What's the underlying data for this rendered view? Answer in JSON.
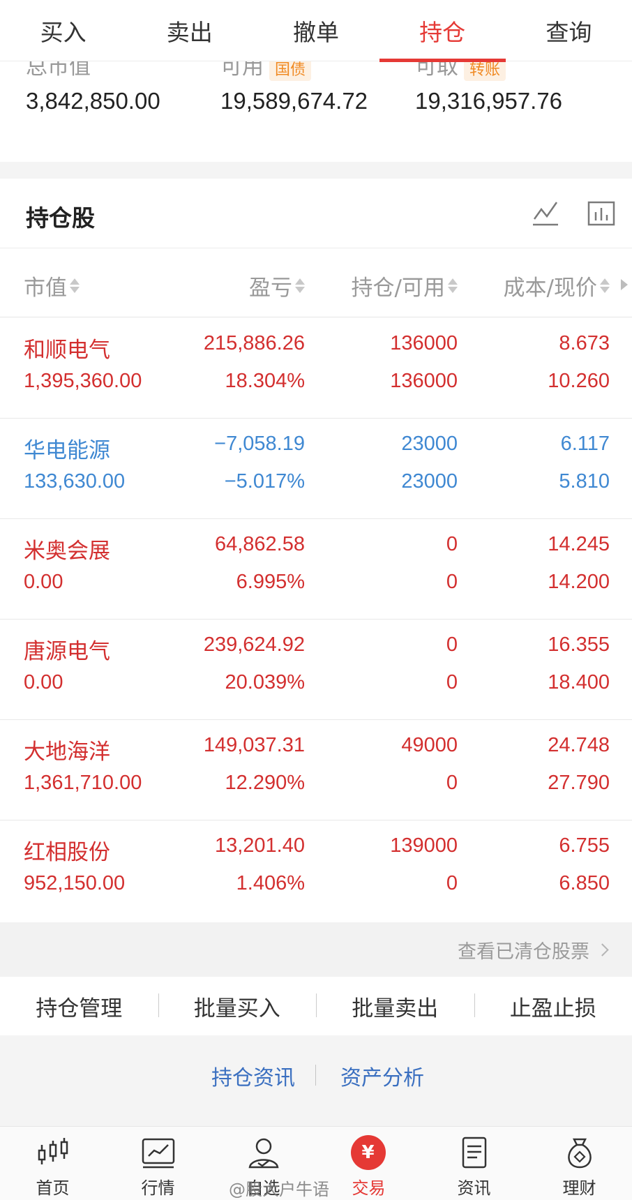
{
  "top_tabs": [
    {
      "label": "买入"
    },
    {
      "label": "卖出"
    },
    {
      "label": "撤单"
    },
    {
      "label": "持仓"
    },
    {
      "label": "查询"
    }
  ],
  "summary": {
    "market_value": {
      "label": "总市值",
      "value": "3,842,850.00"
    },
    "available": {
      "label": "可用",
      "tag": "国债",
      "value": "19,589,674.72"
    },
    "withdrawable": {
      "label": "可取",
      "tag": "转账",
      "value": "19,316,957.76"
    }
  },
  "holdings": {
    "title": "持仓股",
    "icons": [
      "trend-line-icon",
      "bar-chart-icon"
    ],
    "columns": [
      "市值",
      "盈亏",
      "持仓/可用",
      "成本/现价"
    ],
    "rows": [
      {
        "name": "和顺电气",
        "market_value": "1,395,360.00",
        "pnl": "215,886.26",
        "pnl_pct": "18.304%",
        "position": "136000",
        "available": "136000",
        "cost": "8.673",
        "price": "10.260",
        "trend": "up"
      },
      {
        "name": "华电能源",
        "market_value": "133,630.00",
        "pnl": "−7,058.19",
        "pnl_pct": "−5.017%",
        "position": "23000",
        "available": "23000",
        "cost": "6.117",
        "price": "5.810",
        "trend": "down"
      },
      {
        "name": "米奥会展",
        "market_value": "0.00",
        "pnl": "64,862.58",
        "pnl_pct": "6.995%",
        "position": "0",
        "available": "0",
        "cost": "14.245",
        "price": "14.200",
        "trend": "up"
      },
      {
        "name": "唐源电气",
        "market_value": "0.00",
        "pnl": "239,624.92",
        "pnl_pct": "20.039%",
        "position": "0",
        "available": "0",
        "cost": "16.355",
        "price": "18.400",
        "trend": "up"
      },
      {
        "name": "大地海洋",
        "market_value": "1,361,710.00",
        "pnl": "149,037.31",
        "pnl_pct": "12.290%",
        "position": "49000",
        "available": "0",
        "cost": "24.748",
        "price": "27.790",
        "trend": "up"
      },
      {
        "name": "红相股份",
        "market_value": "952,150.00",
        "pnl": "13,201.40",
        "pnl_pct": "1.406%",
        "position": "139000",
        "available": "0",
        "cost": "6.755",
        "price": "6.850",
        "trend": "up"
      }
    ]
  },
  "cleared_link": "查看已清仓股票",
  "actions": [
    "持仓管理",
    "批量买入",
    "批量卖出",
    "止盈止损"
  ],
  "links": [
    "持仓资讯",
    "资产分析"
  ],
  "bottom_nav": [
    {
      "label": "首页",
      "icon": "candlestick-icon"
    },
    {
      "label": "行情",
      "icon": "market-chart-icon"
    },
    {
      "label": "自选",
      "icon": "user-check-icon"
    },
    {
      "label": "交易",
      "icon": "yuan-icon",
      "glyph": "¥"
    },
    {
      "label": "资讯",
      "icon": "document-icon"
    },
    {
      "label": "理财",
      "icon": "money-bag-icon"
    }
  ],
  "watermark": "@股大户牛语",
  "colors": {
    "accent": "#e53935",
    "gain": "#d32f2f",
    "loss": "#3f88d2",
    "link": "#3a6fc0"
  }
}
